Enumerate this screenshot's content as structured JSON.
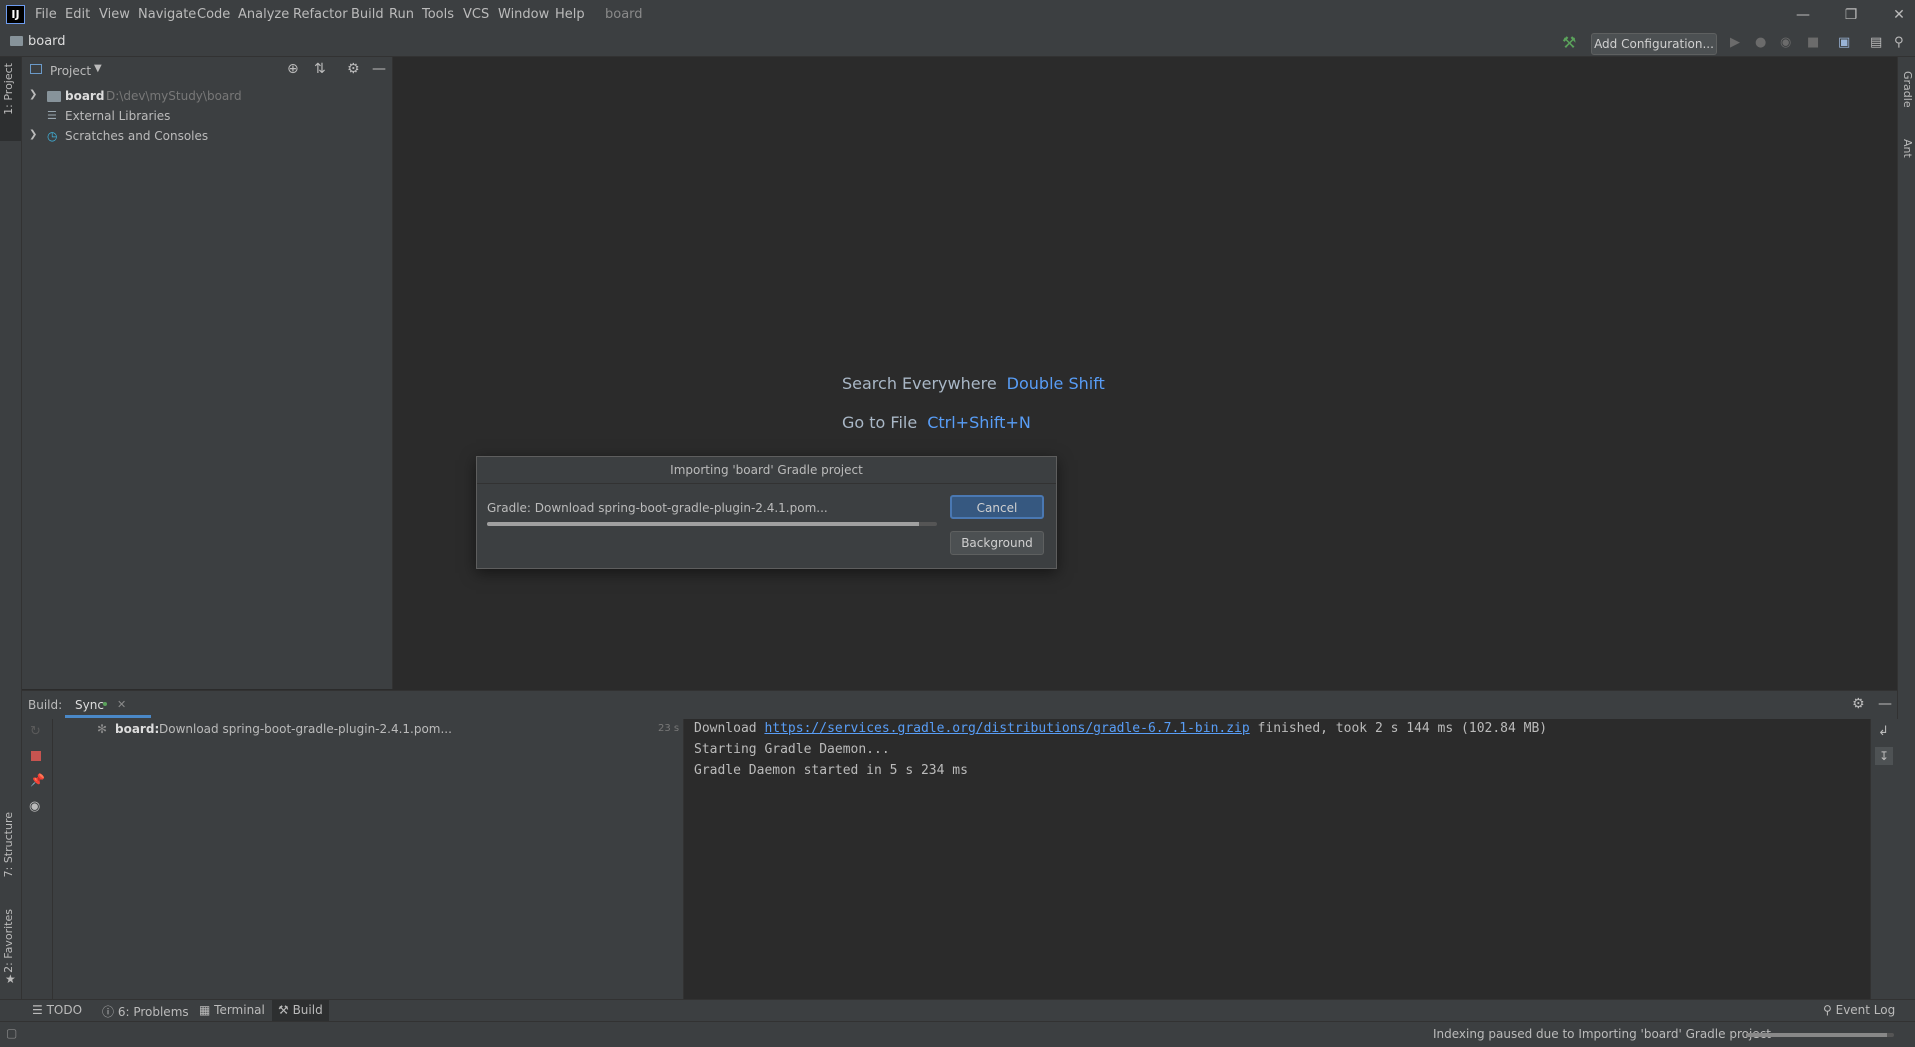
{
  "menubar": {
    "items": [
      "File",
      "Edit",
      "View",
      "Navigate",
      "Code",
      "Analyze",
      "Refactor",
      "Build",
      "Run",
      "Tools",
      "VCS",
      "Window",
      "Help"
    ],
    "window_title": "board"
  },
  "navbar": {
    "breadcrumb": "board",
    "add_configuration": "Add Configuration..."
  },
  "left_stripe": {
    "project_tab": "1: Project",
    "structure_tab": "7: Structure",
    "favorites_tab": "2: Favorites"
  },
  "right_stripe": {
    "gradle_tab": "Gradle",
    "ant_tab": "Ant"
  },
  "project_panel": {
    "title": "Project",
    "tree": [
      {
        "label": "board",
        "path": "D:\\dev\\myStudy\\board"
      },
      {
        "label": "External Libraries"
      },
      {
        "label": "Scratches and Consoles"
      }
    ]
  },
  "editor": {
    "hints": [
      {
        "label": "Search Everywhere",
        "key": "Double Shift"
      },
      {
        "label": "Go to File",
        "key": "Ctrl+Shift+N"
      }
    ]
  },
  "dialog": {
    "title": "Importing 'board' Gradle project",
    "message": "Gradle: Download spring-boot-gradle-plugin-2.4.1.pom...",
    "progress": 0.96,
    "cancel": "Cancel",
    "background": "Background"
  },
  "build": {
    "label": "Build:",
    "tab": "Sync",
    "task_name": "board:",
    "task_desc": "Download spring-boot-gradle-plugin-2.4.1.pom...",
    "task_time": "23 s",
    "console": {
      "line1_prefix": "Download ",
      "line1_link": "https://services.gradle.org/distributions/gradle-6.7.1-bin.zip",
      "line1_suffix": " finished, took 2 s 144 ms (102.84 MB)",
      "line2": "Starting Gradle Daemon...",
      "line3": "Gradle Daemon started in 5 s 234 ms"
    }
  },
  "bottom_tabs": {
    "todo": "TODO",
    "problems": "6: Problems",
    "terminal": "Terminal",
    "build": "Build",
    "event_log": "Event Log"
  },
  "statusbar": {
    "text": "Indexing paused due to Importing 'board' Gradle project",
    "progress": 0.95
  },
  "colors": {
    "accent": "#589df6",
    "run_green": "#5ba35b",
    "stop_red": "#c75450"
  }
}
